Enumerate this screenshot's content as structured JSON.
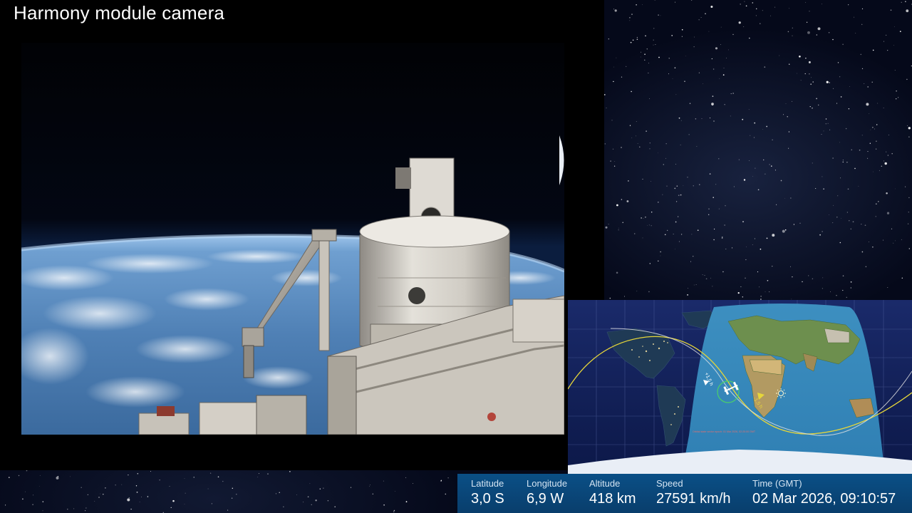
{
  "camera": {
    "title": "Harmony module camera"
  },
  "map": {
    "orbit_label_ahead": "+1,5 h",
    "orbit_label_behind": "-1,5 h",
    "sun_icon": "sun-icon",
    "station_icon": "iss-icon",
    "footer_note": "Orbital state vector epoch: 01 Mar 2026, 02:20:00 GMT"
  },
  "telemetry": {
    "latitude_label": "Latitude",
    "latitude_value": "3,0 S",
    "longitude_label": "Longitude",
    "longitude_value": "6,9 W",
    "altitude_label": "Altitude",
    "altitude_value": "418 km",
    "speed_label": "Speed",
    "speed_value": "27591 km/h",
    "time_label": "Time (GMT)",
    "time_value": "02 Mar 2026, 09:10:57"
  },
  "colors": {
    "telemetry_bg": "#0a4f86",
    "orbit_track": "#e6d63a",
    "ground_track_alt": "#e6e6e6"
  }
}
